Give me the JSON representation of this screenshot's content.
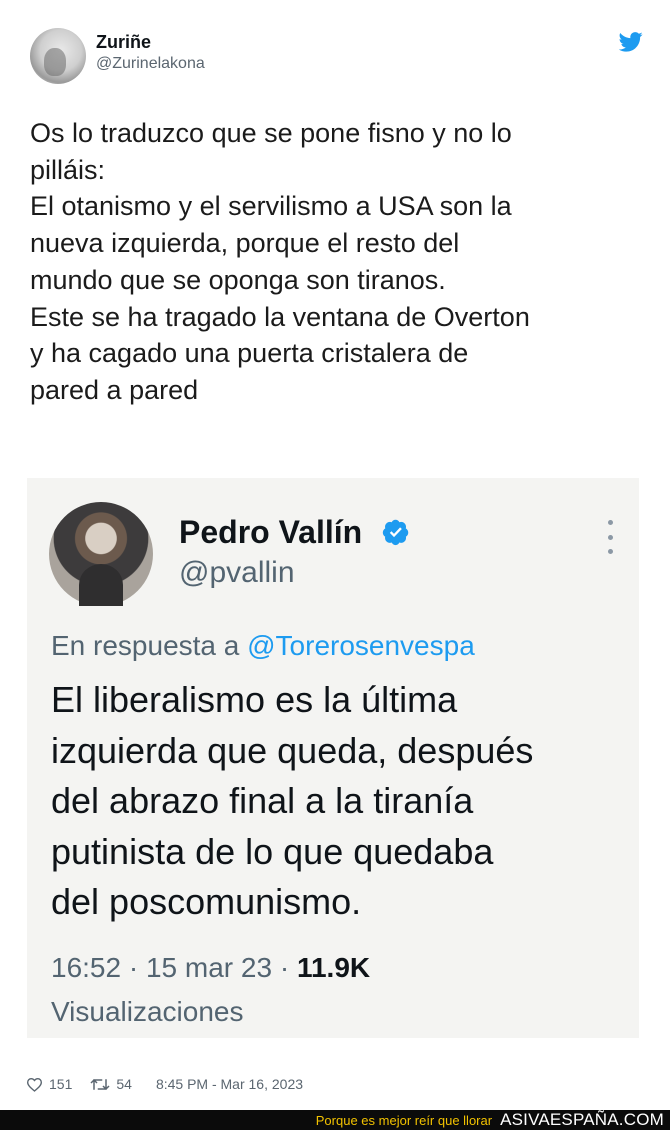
{
  "tweet": {
    "author_name": "Zuriñe",
    "author_handle": "@Zurinelakona",
    "text": "Os lo traduzco que se pone fisno y no lo\npilláis:\nEl otanismo y el servilismo a USA son la\nnueva izquierda, porque el resto del\nmundo que se oponga son tiranos.\nEste se ha tragado la ventana de Overton\ny ha cagado una puerta cristalera de\npared a pared",
    "likes": "151",
    "retweets": "54",
    "timestamp": "8:45 PM - Mar 16, 2023"
  },
  "embedded_tweet": {
    "author_name": "Pedro Vallín",
    "author_handle": "@pvallin",
    "reply_prefix": "En respuesta a",
    "reply_to": "@Torerosenvespa",
    "text": "El liberalismo es la última\nizquierda que queda, después\ndel abrazo final a la tiranía\nputinista de lo que quedaba\ndel poscomunismo.",
    "time": "16:52",
    "date": "15 mar 23",
    "views_count": "11.9K",
    "views_label": "Visualizaciones"
  },
  "footer": {
    "tagline": "Porque es mejor reír que llorar",
    "brand": "ASIVAESPAÑA.COM"
  },
  "icons": {
    "bird": "twitter-bird-icon",
    "verified": "verified-badge-icon",
    "more": "more-vertical-icon",
    "like": "heart-icon",
    "retweet": "retweet-icon"
  },
  "colors": {
    "twitter_blue": "#1d9bf0",
    "footer_tag": "#f2c200",
    "footer_bg": "#0b0b0b"
  }
}
